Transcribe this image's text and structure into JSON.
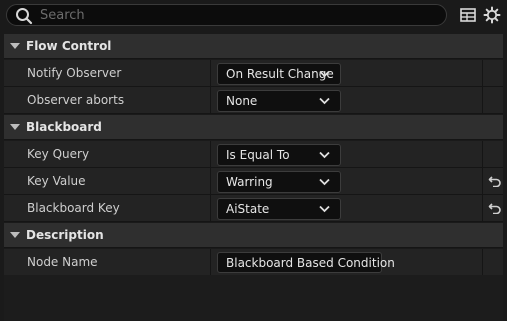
{
  "search": {
    "placeholder": "Search",
    "value": ""
  },
  "toolbar": {
    "table_icon": "table-view-icon",
    "settings_icon": "gear-icon"
  },
  "sections": {
    "flow_control": {
      "title": "Flow Control",
      "notify_observer": {
        "label": "Notify Observer",
        "value": "On Result Change"
      },
      "observer_aborts": {
        "label": "Observer aborts",
        "value": "None"
      }
    },
    "blackboard": {
      "title": "Blackboard",
      "key_query": {
        "label": "Key Query",
        "value": "Is Equal To"
      },
      "key_value": {
        "label": "Key Value",
        "value": "Warring"
      },
      "blackboard_key": {
        "label": "Blackboard Key",
        "value": "AiState"
      }
    },
    "description": {
      "title": "Description",
      "node_name": {
        "label": "Node Name",
        "value": "Blackboard Based Condition"
      }
    }
  },
  "colors": {
    "background": "#1a1a1a",
    "category_bg": "#2f2f2f",
    "row_bg": "#232323",
    "field_bg": "#0f0f0f",
    "text": "#cfcfcf"
  }
}
